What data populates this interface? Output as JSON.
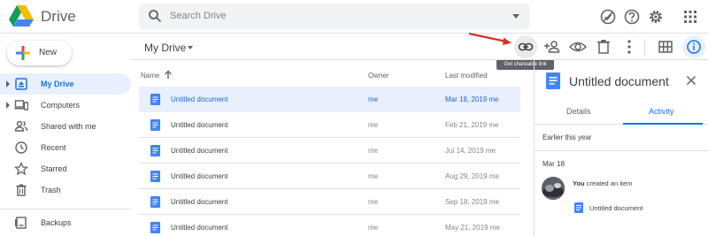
{
  "header": {
    "app_name": "Drive",
    "search_placeholder": "Search Drive",
    "icons": [
      "offline-icon",
      "help-icon",
      "settings-icon",
      "apps-grid-icon"
    ]
  },
  "sidebar": {
    "new_label": "New",
    "items": [
      {
        "label": "My Drive",
        "icon": "my-drive-icon",
        "active": true,
        "expandable": true
      },
      {
        "label": "Computers",
        "icon": "computers-icon",
        "active": false,
        "expandable": true
      },
      {
        "label": "Shared with me",
        "icon": "shared-icon",
        "active": false,
        "expandable": false
      },
      {
        "label": "Recent",
        "icon": "clock-icon",
        "active": false,
        "expandable": false
      },
      {
        "label": "Starred",
        "icon": "star-icon",
        "active": false,
        "expandable": false
      },
      {
        "label": "Trash",
        "icon": "trash-icon",
        "active": false,
        "expandable": false
      },
      {
        "label": "Backups",
        "icon": "backups-icon",
        "active": false,
        "expandable": false
      }
    ]
  },
  "main": {
    "breadcrumb": "My Drive",
    "tooltip": "Get shareable link",
    "toolbar_icons": [
      "link-icon",
      "add-person-icon",
      "preview-eye-icon",
      "delete-icon",
      "more-vert-icon",
      "grid-view-icon",
      "info-icon"
    ],
    "columns": {
      "name": "Name",
      "owner": "Owner",
      "modified": "Last modified"
    },
    "files": [
      {
        "name": "Untitled document",
        "owner": "me",
        "modified": "Mar 18, 2019 me",
        "selected": true
      },
      {
        "name": "Untitled document",
        "owner": "me",
        "modified": "Feb 21, 2019 me",
        "selected": false
      },
      {
        "name": "Untitled document",
        "owner": "me",
        "modified": "Jul 14, 2019 me",
        "selected": false
      },
      {
        "name": "Untitled document",
        "owner": "me",
        "modified": "Aug 29, 2019 me",
        "selected": false
      },
      {
        "name": "Untitled document",
        "owner": "me",
        "modified": "Sep 18, 2019 me",
        "selected": false
      },
      {
        "name": "Untitled document",
        "owner": "me",
        "modified": "May 21, 2019 me",
        "selected": false
      }
    ]
  },
  "details": {
    "title": "Untitled document",
    "tabs": [
      "Details",
      "Activity"
    ],
    "active_tab": "Activity",
    "section": "Earlier this year",
    "date": "Mar 18",
    "activity_actor": "You",
    "activity_text": " created an item",
    "activity_item": "Untitled document"
  },
  "colors": {
    "accent": "#1a73e8",
    "selected_row": "#e8f0fe",
    "doc_blue": "#4285f4",
    "annotation_arrow": "#d93025"
  }
}
